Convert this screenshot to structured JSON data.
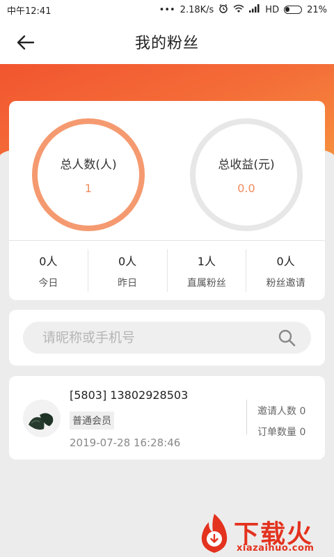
{
  "status_bar": {
    "time": "中午12:41",
    "dots": "•••",
    "speed": "2.18K/s",
    "network": "HD",
    "battery": "21%"
  },
  "nav": {
    "title": "我的粉丝",
    "back_icon": "arrow-left-icon"
  },
  "summary": {
    "total_people_label": "总人数(人)",
    "total_people_value": "1",
    "total_income_label": "总收益(元)",
    "total_income_value": "0.0",
    "left_ring_color": "#f59a70",
    "right_ring_color": "#e7e7e7"
  },
  "stats": [
    {
      "value": "0人",
      "label": "今日"
    },
    {
      "value": "0人",
      "label": "昨日"
    },
    {
      "value": "1人",
      "label": "直属粉丝"
    },
    {
      "value": "0人",
      "label": "粉丝邀请"
    }
  ],
  "search": {
    "placeholder": "请昵称或手机号",
    "icon": "search-icon"
  },
  "fans": [
    {
      "name": "[5803] 13802928503",
      "level": "普通会员",
      "time": "2019-07-28 16:28:46",
      "invite_count": "邀请人数 0",
      "order_count": "订单数量 0"
    }
  ],
  "watermark": {
    "title": "下载火",
    "url": "xiazaihuo.com"
  },
  "colors": {
    "accent": "#f2552f",
    "value_orange": "#f08a5d",
    "watermark_red": "#e3321e"
  }
}
